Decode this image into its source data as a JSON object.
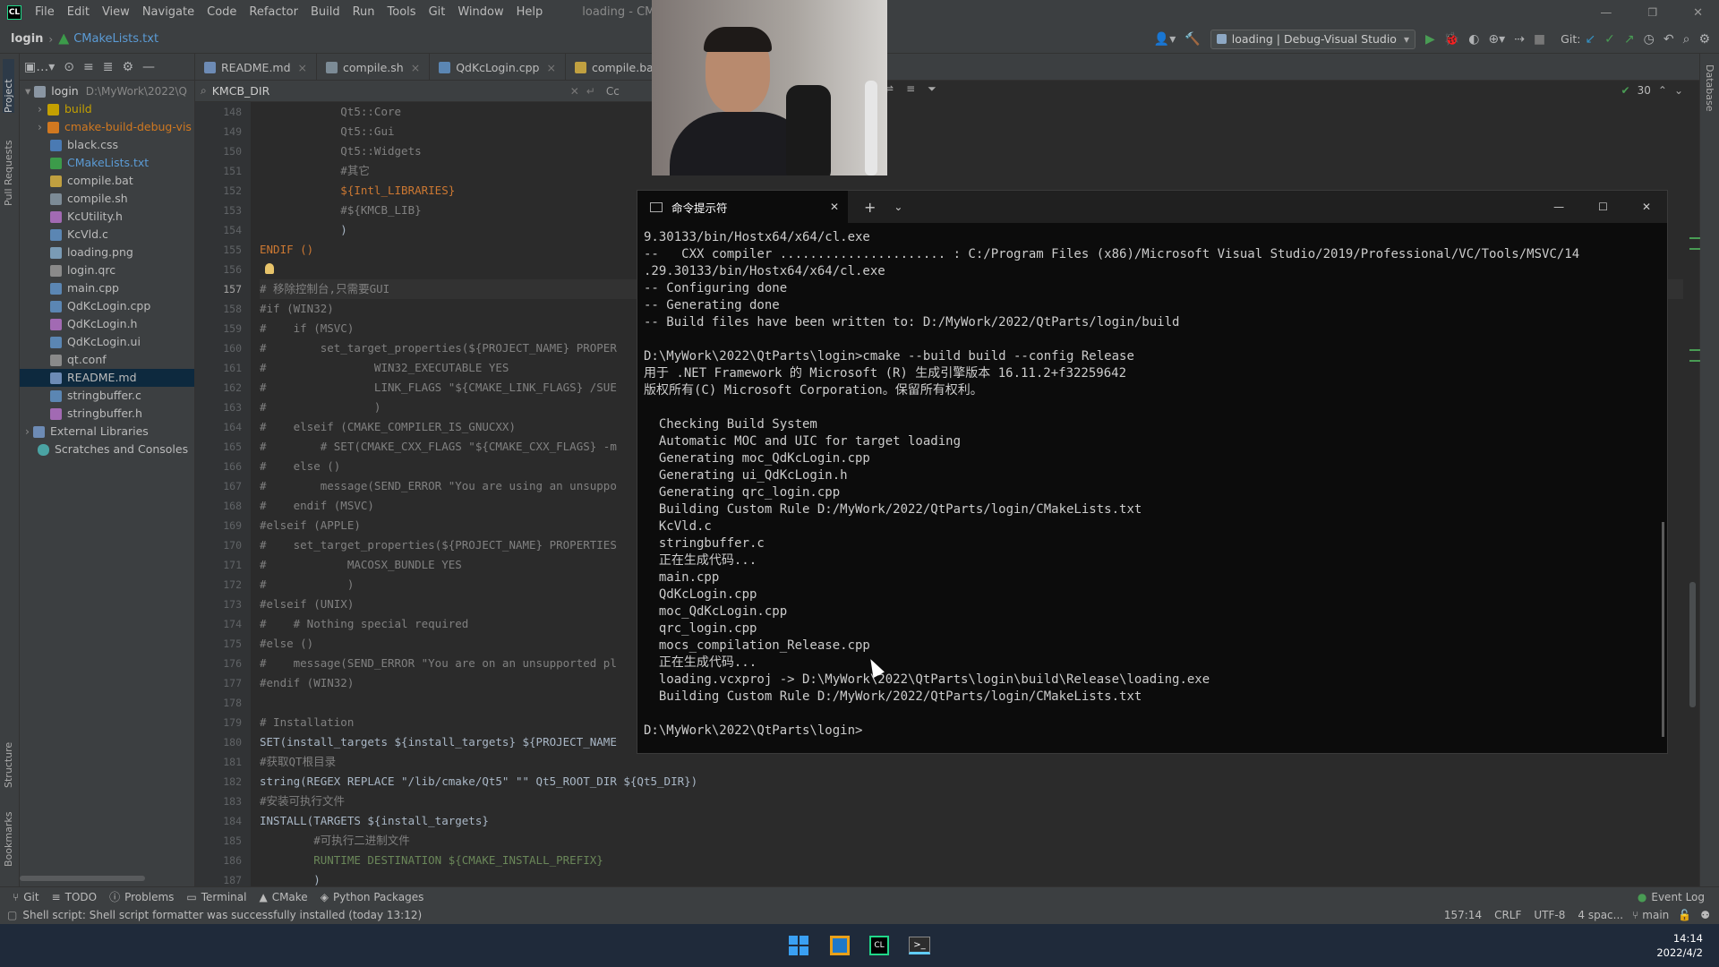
{
  "ide": {
    "window_title": "loading - CMakeLists.txt",
    "menu": [
      "File",
      "Edit",
      "View",
      "Navigate",
      "Code",
      "Refactor",
      "Build",
      "Run",
      "Tools",
      "Git",
      "Window",
      "Help"
    ],
    "breadcrumb_project": "login",
    "breadcrumb_file": "CMakeLists.txt",
    "run_config": "loading | Debug-Visual Studio",
    "git_label": "Git:",
    "tabs": [
      "README.md",
      "compile.sh",
      "QdKcLogin.cpp",
      "compile.bat"
    ],
    "search_query": "KMCB_DIR",
    "match_case": "Cc",
    "inspection_count": "30",
    "left_stripe": [
      "Project",
      "Pull Requests",
      "Structure",
      "Bookmarks"
    ],
    "right_stripe": [
      "Database"
    ]
  },
  "project_tree": {
    "root": "login",
    "root_path": "D:\\MyWork\\2022\\Q",
    "items": [
      {
        "name": "build",
        "kind": "folder",
        "color": "#c4a000"
      },
      {
        "name": "cmake-build-debug-vis",
        "kind": "folder-excluded",
        "color": "#d07820"
      },
      {
        "name": "black.css",
        "kind": "css",
        "color": "#4a7ab3"
      },
      {
        "name": "CMakeLists.txt",
        "kind": "cmake",
        "color": "#3c9b4a"
      },
      {
        "name": "compile.bat",
        "kind": "bat",
        "color": "#c0a040"
      },
      {
        "name": "compile.sh",
        "kind": "sh",
        "color": "#7c8b96"
      },
      {
        "name": "KcUtility.h",
        "kind": "h",
        "color": "#a26ab3"
      },
      {
        "name": "KcVld.c",
        "kind": "c",
        "color": "#5b86b3"
      },
      {
        "name": "loading.png",
        "kind": "png",
        "color": "#7a9bb5"
      },
      {
        "name": "login.qrc",
        "kind": "qrc",
        "color": "#8a8a8a"
      },
      {
        "name": "main.cpp",
        "kind": "cpp",
        "color": "#5b86b3"
      },
      {
        "name": "QdKcLogin.cpp",
        "kind": "cpp",
        "color": "#5b86b3"
      },
      {
        "name": "QdKcLogin.h",
        "kind": "h",
        "color": "#a26ab3"
      },
      {
        "name": "QdKcLogin.ui",
        "kind": "ui",
        "color": "#5b86b3"
      },
      {
        "name": "qt.conf",
        "kind": "conf",
        "color": "#8a8a8a"
      },
      {
        "name": "README.md",
        "kind": "md",
        "color": "#6d8bb5",
        "selected": true
      },
      {
        "name": "stringbuffer.c",
        "kind": "c",
        "color": "#5b86b3"
      },
      {
        "name": "stringbuffer.h",
        "kind": "h",
        "color": "#a26ab3"
      }
    ],
    "external_libraries": "External Libraries",
    "scratches": "Scratches and Consoles"
  },
  "editor": {
    "lines": [
      {
        "n": "148",
        "text": "            Qt5::Core",
        "cls": "c-com"
      },
      {
        "n": "149",
        "text": "            Qt5::Gui",
        "cls": "c-com"
      },
      {
        "n": "150",
        "text": "            Qt5::Widgets",
        "cls": "c-com"
      },
      {
        "n": "151",
        "text": "            #其它",
        "cls": "c-com"
      },
      {
        "n": "152",
        "text": "            ${Intl_LIBRARIES}",
        "cls": "c-kw"
      },
      {
        "n": "153",
        "text": "            #${KMCB_LIB}",
        "cls": "c-com"
      },
      {
        "n": "154",
        "text": "            )",
        "cls": ""
      },
      {
        "n": "155",
        "text": "ENDIF ()",
        "cls": "c-kw"
      },
      {
        "n": "156",
        "text": "",
        "cls": ""
      },
      {
        "n": "157",
        "text": "# 移除控制台,只需要GUI",
        "cls": "c-com"
      },
      {
        "n": "158",
        "text": "#if (WIN32)",
        "cls": "c-com"
      },
      {
        "n": "159",
        "text": "#    if (MSVC)",
        "cls": "c-com"
      },
      {
        "n": "160",
        "text": "#        set_target_properties(${PROJECT_NAME} PROPER",
        "cls": "c-com"
      },
      {
        "n": "161",
        "text": "#                WIN32_EXECUTABLE YES",
        "cls": "c-com"
      },
      {
        "n": "162",
        "text": "#                LINK_FLAGS \"${CMAKE_LINK_FLAGS} /SUE",
        "cls": "c-com"
      },
      {
        "n": "163",
        "text": "#                )",
        "cls": "c-com"
      },
      {
        "n": "164",
        "text": "#    elseif (CMAKE_COMPILER_IS_GNUCXX)",
        "cls": "c-com"
      },
      {
        "n": "165",
        "text": "#        # SET(CMAKE_CXX_FLAGS \"${CMAKE_CXX_FLAGS} -m",
        "cls": "c-com"
      },
      {
        "n": "166",
        "text": "#    else ()",
        "cls": "c-com"
      },
      {
        "n": "167",
        "text": "#        message(SEND_ERROR \"You are using an unsuppo",
        "cls": "c-com"
      },
      {
        "n": "168",
        "text": "#    endif (MSVC)",
        "cls": "c-com"
      },
      {
        "n": "169",
        "text": "#elseif (APPLE)",
        "cls": "c-com"
      },
      {
        "n": "170",
        "text": "#    set_target_properties(${PROJECT_NAME} PROPERTIES",
        "cls": "c-com"
      },
      {
        "n": "171",
        "text": "#            MACOSX_BUNDLE YES",
        "cls": "c-com"
      },
      {
        "n": "172",
        "text": "#            )",
        "cls": "c-com"
      },
      {
        "n": "173",
        "text": "#elseif (UNIX)",
        "cls": "c-com"
      },
      {
        "n": "174",
        "text": "#    # Nothing special required",
        "cls": "c-com"
      },
      {
        "n": "175",
        "text": "#else ()",
        "cls": "c-com"
      },
      {
        "n": "176",
        "text": "#    message(SEND_ERROR \"You are on an unsupported pl",
        "cls": "c-com"
      },
      {
        "n": "177",
        "text": "#endif (WIN32)",
        "cls": "c-com"
      },
      {
        "n": "178",
        "text": "",
        "cls": ""
      },
      {
        "n": "179",
        "text": "# Installation",
        "cls": "c-com"
      },
      {
        "n": "180",
        "text": "SET(install_targets ${install_targets} ${PROJECT_NAME",
        "cls": ""
      },
      {
        "n": "181",
        "text": "#获取QT根目录",
        "cls": "c-com"
      },
      {
        "n": "182",
        "text": "string(REGEX REPLACE \"/lib/cmake/Qt5\" \"\" Qt5_ROOT_DIR ${Qt5_DIR})",
        "cls": ""
      },
      {
        "n": "183",
        "text": "#安装可执行文件",
        "cls": "c-com"
      },
      {
        "n": "184",
        "text": "INSTALL(TARGETS ${install_targets}",
        "cls": ""
      },
      {
        "n": "185",
        "text": "        #可执行二进制文件",
        "cls": "c-com"
      },
      {
        "n": "186",
        "text": "        RUNTIME DESTINATION ${CMAKE_INSTALL_PREFIX}",
        "cls": "c-str"
      },
      {
        "n": "187",
        "text": "        )",
        "cls": ""
      }
    ]
  },
  "terminal": {
    "tab_title": "命令提示符",
    "lines": [
      "9.30133/bin/Hostx64/x64/cl.exe",
      "--   CXX compiler ...................... : C:/Program Files (x86)/Microsoft Visual Studio/2019/Professional/VC/Tools/MSVC/14",
      ".29.30133/bin/Hostx64/x64/cl.exe",
      "-- Configuring done",
      "-- Generating done",
      "-- Build files have been written to: D:/MyWork/2022/QtParts/login/build",
      "",
      "D:\\MyWork\\2022\\QtParts\\login>cmake --build build --config Release",
      "用于 .NET Framework 的 Microsoft (R) 生成引擎版本 16.11.2+f32259642",
      "版权所有(C) Microsoft Corporation。保留所有权利。",
      "",
      "  Checking Build System",
      "  Automatic MOC and UIC for target loading",
      "  Generating moc_QdKcLogin.cpp",
      "  Generating ui_QdKcLogin.h",
      "  Generating qrc_login.cpp",
      "  Building Custom Rule D:/MyWork/2022/QtParts/login/CMakeLists.txt",
      "  KcVld.c",
      "  stringbuffer.c",
      "  正在生成代码...",
      "  main.cpp",
      "  QdKcLogin.cpp",
      "  moc_QdKcLogin.cpp",
      "  qrc_login.cpp",
      "  mocs_compilation_Release.cpp",
      "  正在生成代码...",
      "  loading.vcxproj -> D:\\MyWork\\2022\\QtParts\\login\\build\\Release\\loading.exe",
      "  Building Custom Rule D:/MyWork/2022/QtParts/login/CMakeLists.txt",
      "",
      "D:\\MyWork\\2022\\QtParts\\login>"
    ]
  },
  "tool_windows": [
    "Git",
    "TODO",
    "Problems",
    "Terminal",
    "CMake",
    "Python Packages"
  ],
  "event_log": "Event Log",
  "status": {
    "message": "Shell script: Shell script formatter was successfully installed (today 13:12)",
    "position": "157:14",
    "line_sep": "CRLF",
    "encoding": "UTF-8",
    "indent": "4 spac...",
    "branch": "main"
  },
  "taskbar": {
    "time": "14:14",
    "date": "2022/4/2"
  }
}
